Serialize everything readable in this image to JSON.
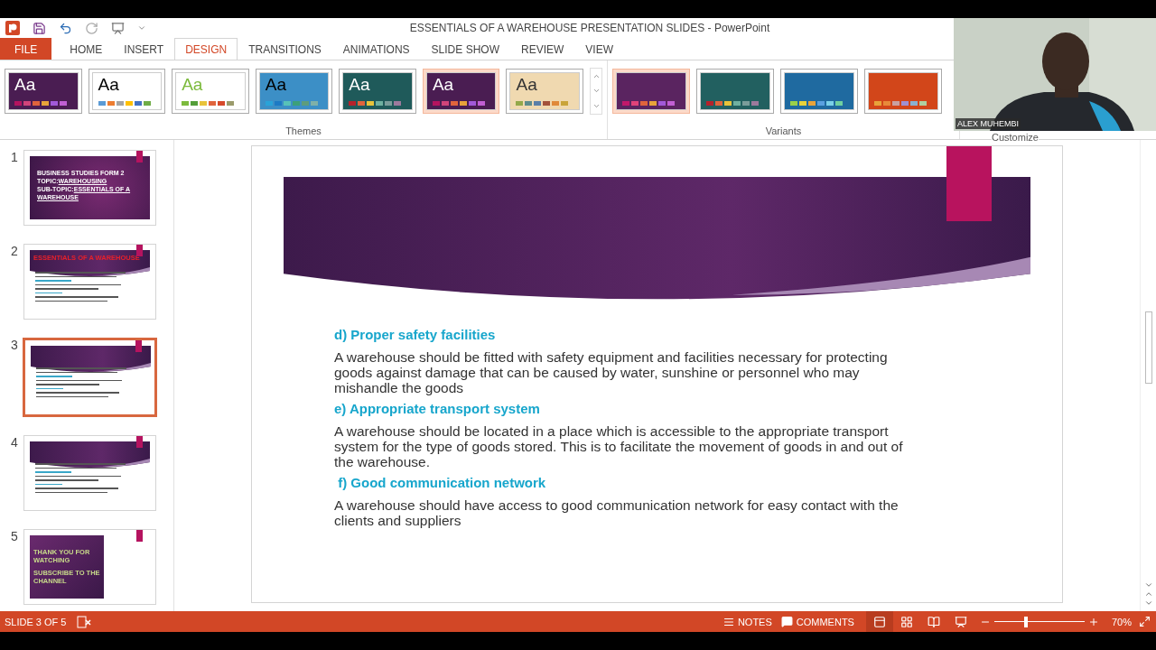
{
  "window": {
    "title": "ESSENTIALS OF A WAREHOUSE PRESENTATION SLIDES - PowerPoint"
  },
  "tabs": [
    {
      "label": "FILE",
      "kind": "file",
      "selected": false
    },
    {
      "label": "HOME",
      "kind": "tab",
      "selected": false
    },
    {
      "label": "INSERT",
      "kind": "tab",
      "selected": false
    },
    {
      "label": "DESIGN",
      "kind": "tab",
      "selected": true
    },
    {
      "label": "TRANSITIONS",
      "kind": "tab",
      "selected": false
    },
    {
      "label": "ANIMATIONS",
      "kind": "tab",
      "selected": false
    },
    {
      "label": "SLIDE SHOW",
      "kind": "tab",
      "selected": false
    },
    {
      "label": "REVIEW",
      "kind": "tab",
      "selected": false
    },
    {
      "label": "VIEW",
      "kind": "tab",
      "selected": false
    }
  ],
  "themes": {
    "label": "Themes",
    "items": [
      {
        "sample": {
          "text": "Aa",
          "color": "#ffffff"
        },
        "color": "#4a1d52",
        "selected": false,
        "swatches": [
          {
            "color": "#b5135f"
          },
          {
            "color": "#d1447a"
          },
          {
            "color": "#e0643c"
          },
          {
            "color": "#e8a33a"
          },
          {
            "color": "#a259d9"
          },
          {
            "color": "#c15fd4"
          }
        ]
      },
      {
        "sample": {
          "text": "Aa",
          "color": "#000000"
        },
        "color": "#ffffff",
        "selected": false,
        "swatches": [
          {
            "color": "#5b9bd5"
          },
          {
            "color": "#ed7d31"
          },
          {
            "color": "#a5a5a5"
          },
          {
            "color": "#ffc000"
          },
          {
            "color": "#4472c4"
          },
          {
            "color": "#70ad47"
          }
        ]
      },
      {
        "sample": {
          "text": "Aa",
          "color": "#7cba3c"
        },
        "color": "#ffffff",
        "selected": false,
        "swatches": [
          {
            "color": "#7cba3c"
          },
          {
            "color": "#549e39"
          },
          {
            "color": "#e8c33a"
          },
          {
            "color": "#e0643c"
          },
          {
            "color": "#d6492a"
          },
          {
            "color": "#9b9b6b"
          }
        ]
      },
      {
        "sample": {
          "text": "Aa",
          "color": "#000000"
        },
        "color": "#3c8fc6",
        "selected": false,
        "swatches": [
          {
            "color": "#29a3d8"
          },
          {
            "color": "#1c7ac4"
          },
          {
            "color": "#58c2b8"
          },
          {
            "color": "#3ca07a"
          },
          {
            "color": "#5d9c7d"
          },
          {
            "color": "#7fb0a8"
          }
        ]
      },
      {
        "sample": {
          "text": "Aa",
          "color": "#ffffff"
        },
        "color": "#1f5a5a",
        "selected": false,
        "swatches": [
          {
            "color": "#b5222b"
          },
          {
            "color": "#e0643c"
          },
          {
            "color": "#e8c33a"
          },
          {
            "color": "#6fb0a0"
          },
          {
            "color": "#7a9c9a"
          },
          {
            "color": "#9c7a9c"
          }
        ]
      },
      {
        "sample": {
          "text": "Aa",
          "color": "#ffffff"
        },
        "color": "#4a1d52",
        "selected": true,
        "swatches": [
          {
            "color": "#b5135f"
          },
          {
            "color": "#d1447a"
          },
          {
            "color": "#e0643c"
          },
          {
            "color": "#e8a33a"
          },
          {
            "color": "#a259d9"
          },
          {
            "color": "#c15fd4"
          }
        ]
      },
      {
        "sample": {
          "text": "Aa",
          "color": "#333333"
        },
        "color": "#f0d9b0",
        "selected": false,
        "swatches": [
          {
            "color": "#93a84a"
          },
          {
            "color": "#5e8c8c"
          },
          {
            "color": "#5a7fa8"
          },
          {
            "color": "#a3523a"
          },
          {
            "color": "#e08a3a"
          },
          {
            "color": "#c9a43a"
          }
        ]
      }
    ]
  },
  "variants": {
    "label": "Variants",
    "items": [
      {
        "color": "#5a2460",
        "selected": true,
        "swatches": [
          {
            "color": "#c2186b"
          },
          {
            "color": "#e0437a"
          },
          {
            "color": "#e0643c"
          },
          {
            "color": "#e8a33a"
          },
          {
            "color": "#a259d9"
          },
          {
            "color": "#c15fd4"
          }
        ]
      },
      {
        "color": "#226060",
        "selected": false,
        "swatches": [
          {
            "color": "#b5222b"
          },
          {
            "color": "#e0643c"
          },
          {
            "color": "#e8c33a"
          },
          {
            "color": "#6fb0a0"
          },
          {
            "color": "#7a9c9a"
          },
          {
            "color": "#9c7a9c"
          }
        ]
      },
      {
        "color": "#1f6aa0",
        "selected": false,
        "swatches": [
          {
            "color": "#9ad14a"
          },
          {
            "color": "#e8d23a"
          },
          {
            "color": "#e8a33a"
          },
          {
            "color": "#5aa0e0"
          },
          {
            "color": "#7ad0e8"
          },
          {
            "color": "#6fd0a0"
          }
        ]
      },
      {
        "color": "#d2461a",
        "selected": false,
        "swatches": [
          {
            "color": "#e8a33a"
          },
          {
            "color": "#e88a3a"
          },
          {
            "color": "#c9a0a0"
          },
          {
            "color": "#a090d0"
          },
          {
            "color": "#8ab0d0"
          },
          {
            "color": "#b0d0a0"
          }
        ]
      }
    ]
  },
  "customize": {
    "label": "Customize"
  },
  "slides": [
    {
      "number": "1",
      "kind": "title",
      "selected": false,
      "lines": [
        {
          "label": "BUSINESS STUDIES FORM 2"
        },
        {
          "label": "TOPIC:",
          "value": "WAREHOUSING"
        },
        {
          "label": "SUB-TOPIC:",
          "value": "ESSENTIALS OF A WAREHOUSE"
        }
      ]
    },
    {
      "number": "2",
      "kind": "content",
      "selected": false,
      "heading": "ESSENTIALS OF A WAREHOUSE"
    },
    {
      "number": "3",
      "kind": "content",
      "selected": true
    },
    {
      "number": "4",
      "kind": "content",
      "selected": false
    },
    {
      "number": "5",
      "kind": "closing",
      "selected": false,
      "lines": [
        {
          "label": "THANK YOU FOR WATCHING"
        },
        {
          "label": "SUBSCRIBE TO THE CHANNEL"
        }
      ]
    }
  ],
  "current_slide": {
    "sections": [
      {
        "heading": "d) Proper safety facilities",
        "body": "A warehouse should be fitted with safety equipment and facilities necessary for protecting goods against damage that can be caused by water, sunshine or personnel who may mishandle the goods"
      },
      {
        "heading": "e) Appropriate transport system",
        "body": "A warehouse should be located in a place which is accessible to the appropriate transport system for the type of goods stored. This is to facilitate the movement of goods in and out of the warehouse."
      },
      {
        "heading": " f) Good communication network",
        "body": "A warehouse should have access to good communication network for easy contact with the clients and suppliers"
      }
    ]
  },
  "status_bar": {
    "slide_info": "SLIDE 3 OF 5",
    "notes": "NOTES",
    "comments": "COMMENTS",
    "zoom": {
      "level": 0.35,
      "reading": "70%"
    }
  },
  "webcam": {
    "kind": "picture",
    "name": "ALEX MUHEMBI"
  }
}
